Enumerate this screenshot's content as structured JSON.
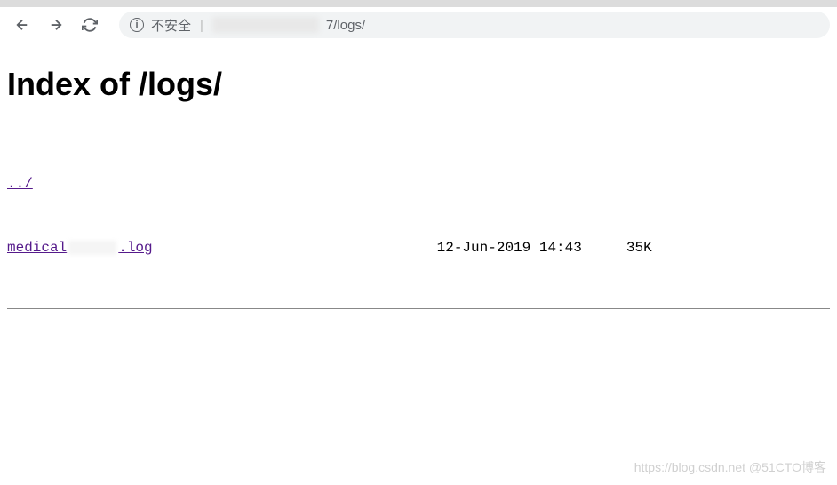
{
  "toolbar": {
    "security_label": "不安全",
    "url_suffix": "7/logs/"
  },
  "page": {
    "title": "Index of /logs/"
  },
  "listing": {
    "parent": "../",
    "files": [
      {
        "name_prefix": "medical",
        "name_suffix": ".log",
        "date": "12-Jun-2019 14:43",
        "size": "35K"
      }
    ]
  },
  "watermark": {
    "text": "https://blog.csdn.net @51CTO博客"
  }
}
